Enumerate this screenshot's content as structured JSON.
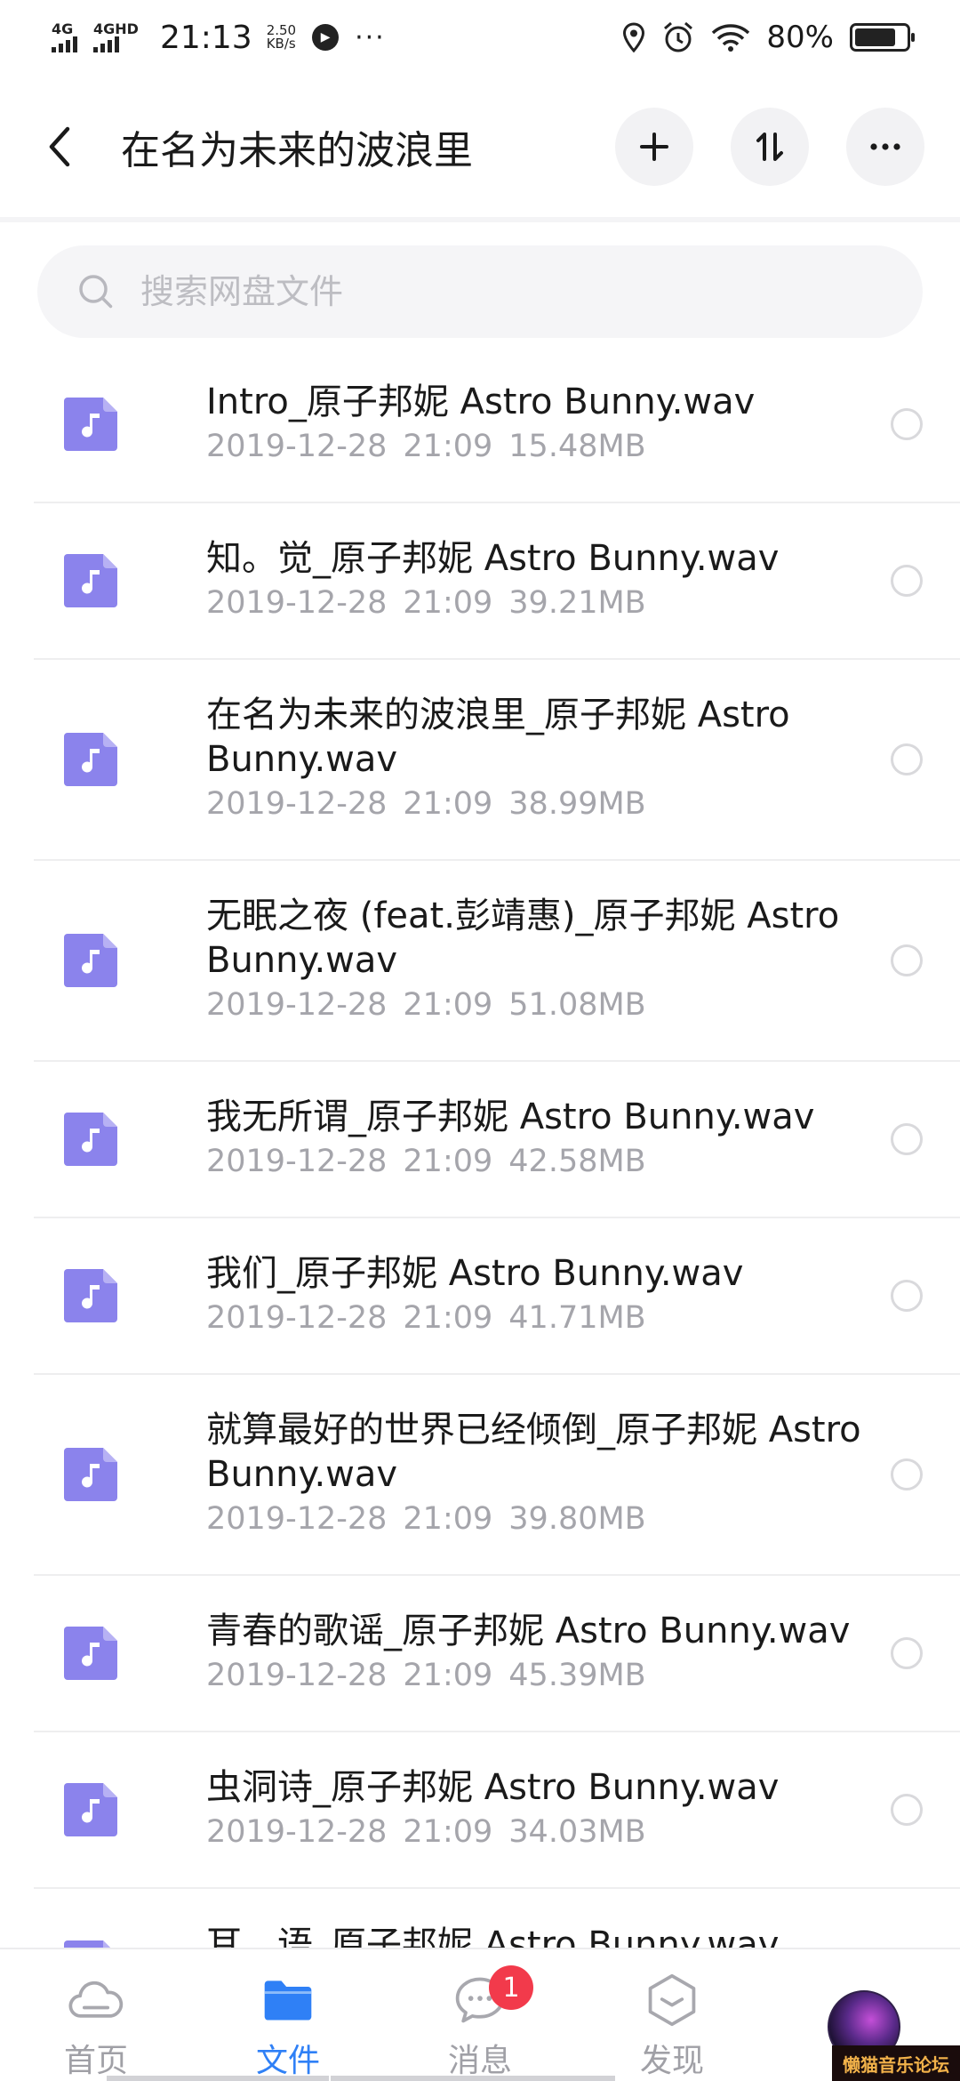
{
  "status_bar": {
    "sim1": "4G",
    "sim2": "4GHD",
    "time": "21:13",
    "speed_value": "2.50",
    "speed_unit": "KB/s",
    "more": "···",
    "battery_percent": "80%",
    "battery_level": 0.8
  },
  "header": {
    "title": "在名为未来的波浪里"
  },
  "search": {
    "placeholder": "搜索网盘文件"
  },
  "files": [
    {
      "name": "Intro_原子邦妮 Astro Bunny.wav",
      "date": "2019-12-28",
      "time": "21:09",
      "size": "15.48MB"
    },
    {
      "name": "知。觉_原子邦妮 Astro Bunny.wav",
      "date": "2019-12-28",
      "time": "21:09",
      "size": "39.21MB"
    },
    {
      "name": "在名为未来的波浪里_原子邦妮 Astro Bunny.wav",
      "date": "2019-12-28",
      "time": "21:09",
      "size": "38.99MB"
    },
    {
      "name": "无眠之夜 (feat.彭靖惠)_原子邦妮 Astro Bunny.wav",
      "date": "2019-12-28",
      "time": "21:09",
      "size": "51.08MB"
    },
    {
      "name": "我无所谓_原子邦妮 Astro Bunny.wav",
      "date": "2019-12-28",
      "time": "21:09",
      "size": "42.58MB"
    },
    {
      "name": "我们_原子邦妮 Astro Bunny.wav",
      "date": "2019-12-28",
      "time": "21:09",
      "size": "41.71MB"
    },
    {
      "name": "就算最好的世界已经倾倒_原子邦妮 Astro Bunny.wav",
      "date": "2019-12-28",
      "time": "21:09",
      "size": "39.80MB"
    },
    {
      "name": "青春的歌谣_原子邦妮 Astro Bunny.wav",
      "date": "2019-12-28",
      "time": "21:09",
      "size": "45.39MB"
    },
    {
      "name": "虫洞诗_原子邦妮 Astro Bunny.wav",
      "date": "2019-12-28",
      "time": "21:09",
      "size": "34.03MB"
    },
    {
      "name": "耳。语_原子邦妮 Astro Bunny.wav",
      "date": "",
      "time": "",
      "size": ""
    }
  ],
  "bottom_nav": {
    "home": "首页",
    "files": "文件",
    "messages": "消息",
    "messages_badge": "1",
    "discover": "发现"
  },
  "watermark": "懒猫音乐论坛",
  "colors": {
    "accent": "#2f80f6",
    "file_icon": "#8b83ec",
    "badge": "#f23a4b"
  }
}
